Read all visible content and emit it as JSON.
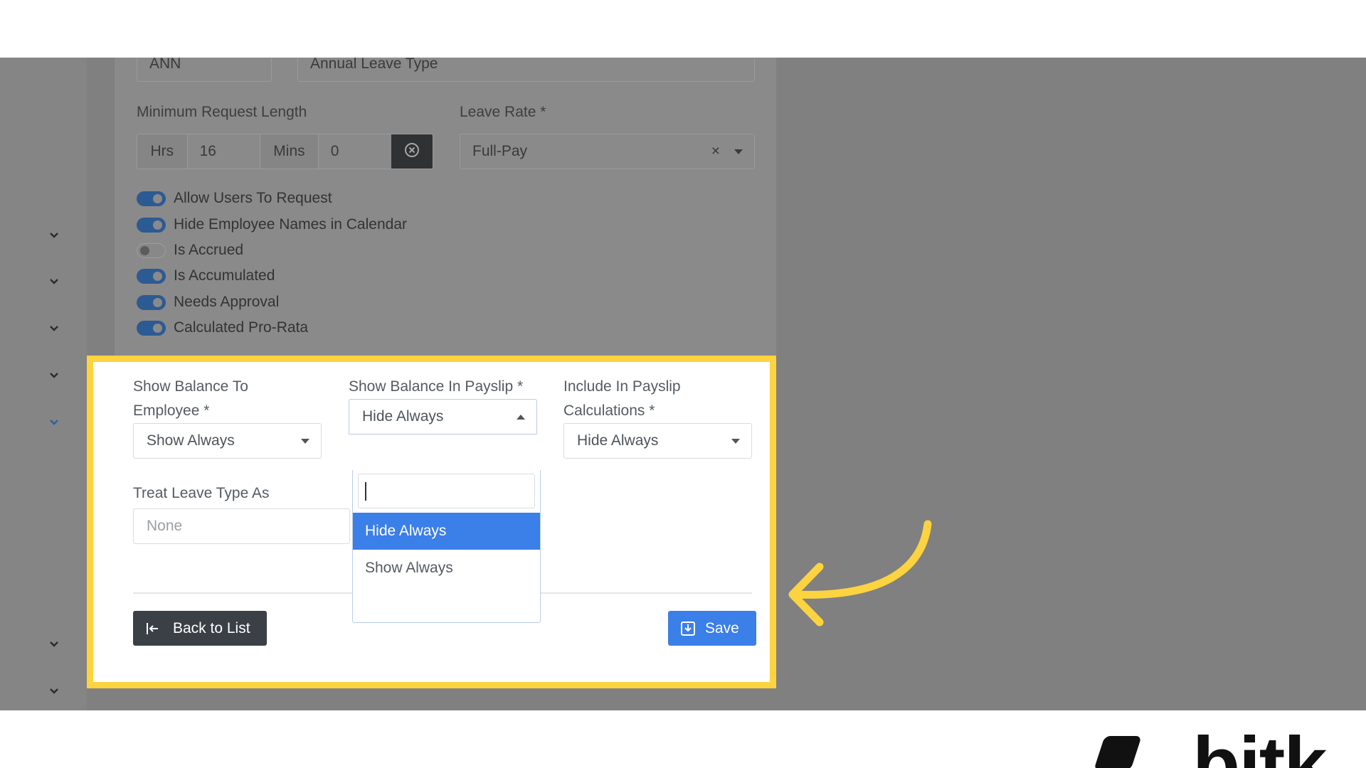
{
  "form_top": {
    "code_value": "ANN",
    "name_value": "Annual Leave Type",
    "min_request_label": "Minimum Request Length",
    "hrs_label": "Hrs",
    "hrs_value": "16",
    "mins_label": "Mins",
    "mins_value": "0",
    "leave_rate_label": "Leave Rate *",
    "leave_rate_value": "Full-Pay",
    "leave_rate_clear": "×"
  },
  "toggles": [
    {
      "label": "Allow Users To Request",
      "on": true
    },
    {
      "label": "Hide Employee Names in Calendar",
      "on": true
    },
    {
      "label": "Is Accrued",
      "on": false
    },
    {
      "label": "Is Accumulated",
      "on": true
    },
    {
      "label": "Needs Approval",
      "on": true
    },
    {
      "label": "Calculated Pro-Rata",
      "on": true
    }
  ],
  "balance": {
    "employee_label_line1": "Show Balance To",
    "employee_label_line2": "Employee *",
    "employee_value": "Show Always",
    "payslip_label": "Show Balance In Payslip *",
    "payslip_value": "Hide Always",
    "calc_label_line1": "Include In Payslip",
    "calc_label_line2": "Calculations *",
    "calc_value": "Hide Always",
    "treat_label": "Treat Leave Type As",
    "treat_placeholder": "None"
  },
  "dropdown": {
    "search_value": "",
    "options": [
      "Hide Always",
      "Show Always"
    ],
    "selected": "Hide Always"
  },
  "actions": {
    "back_label": "Back to List",
    "save_label": "Save"
  },
  "brand": {
    "text": "bitk"
  },
  "colors": {
    "highlight": "#fdd33f",
    "primary": "#3b7fe8",
    "dark_button": "#3b4047"
  }
}
